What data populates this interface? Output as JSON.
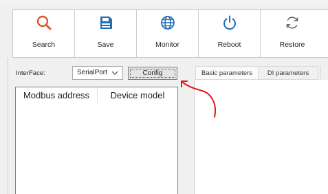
{
  "toolbar": {
    "buttons": [
      {
        "label": "Search",
        "icon": "search-icon"
      },
      {
        "label": "Save",
        "icon": "save-icon"
      },
      {
        "label": "Monitor",
        "icon": "globe-icon"
      },
      {
        "label": "Reboot",
        "icon": "power-icon"
      },
      {
        "label": "Restore",
        "icon": "refresh-icon"
      }
    ]
  },
  "interface": {
    "label": "InterFace:",
    "selected": "SerialPort",
    "config_label": "Config"
  },
  "device_table": {
    "columns": [
      "Modbus address",
      "Device model"
    ]
  },
  "tabs": [
    "Basic parameters",
    "DI parameters"
  ],
  "colors": {
    "search_icon": "#e0522d",
    "save_icon": "#1f6fb5",
    "monitor_icon": "#1f6fb5",
    "reboot_icon": "#1f6fb5",
    "restore_icon": "#666666",
    "annotation": "#e0181f"
  }
}
